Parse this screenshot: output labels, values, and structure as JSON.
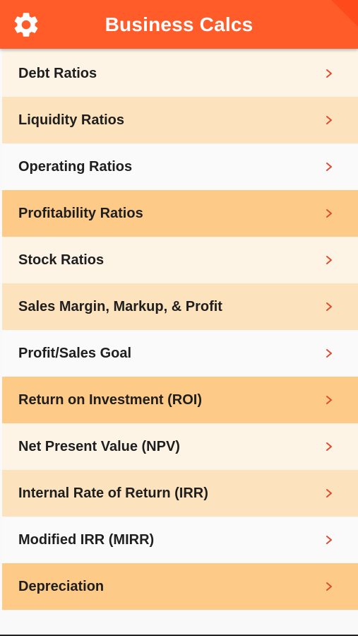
{
  "header": {
    "title": "Business Calcs",
    "settings_icon": "gear-icon",
    "background_color": "#ff5c29"
  },
  "menu": {
    "items": [
      {
        "label": "Debt Ratios",
        "color": "#fef4e6"
      },
      {
        "label": "Liquidity Ratios",
        "color": "#fde3bd"
      },
      {
        "label": "Operating Ratios",
        "color": "#fafafa"
      },
      {
        "label": "Profitability Ratios",
        "color": "#fdca88"
      },
      {
        "label": "Stock Ratios",
        "color": "#fef4e6"
      },
      {
        "label": "Sales Margin, Markup, & Profit",
        "color": "#fde3bd"
      },
      {
        "label": "Profit/Sales Goal",
        "color": "#fafafa"
      },
      {
        "label": "Return on Investment (ROI)",
        "color": "#fdca88"
      },
      {
        "label": "Net Present Value (NPV)",
        "color": "#fef4e6"
      },
      {
        "label": "Internal Rate of Return (IRR)",
        "color": "#fde3bd"
      },
      {
        "label": "Modified IRR (MIRR)",
        "color": "#fafafa"
      },
      {
        "label": "Depreciation",
        "color": "#fdca88"
      }
    ],
    "chevron_icon": "chevron-right-icon",
    "chevron_color": "#e04b2c"
  }
}
